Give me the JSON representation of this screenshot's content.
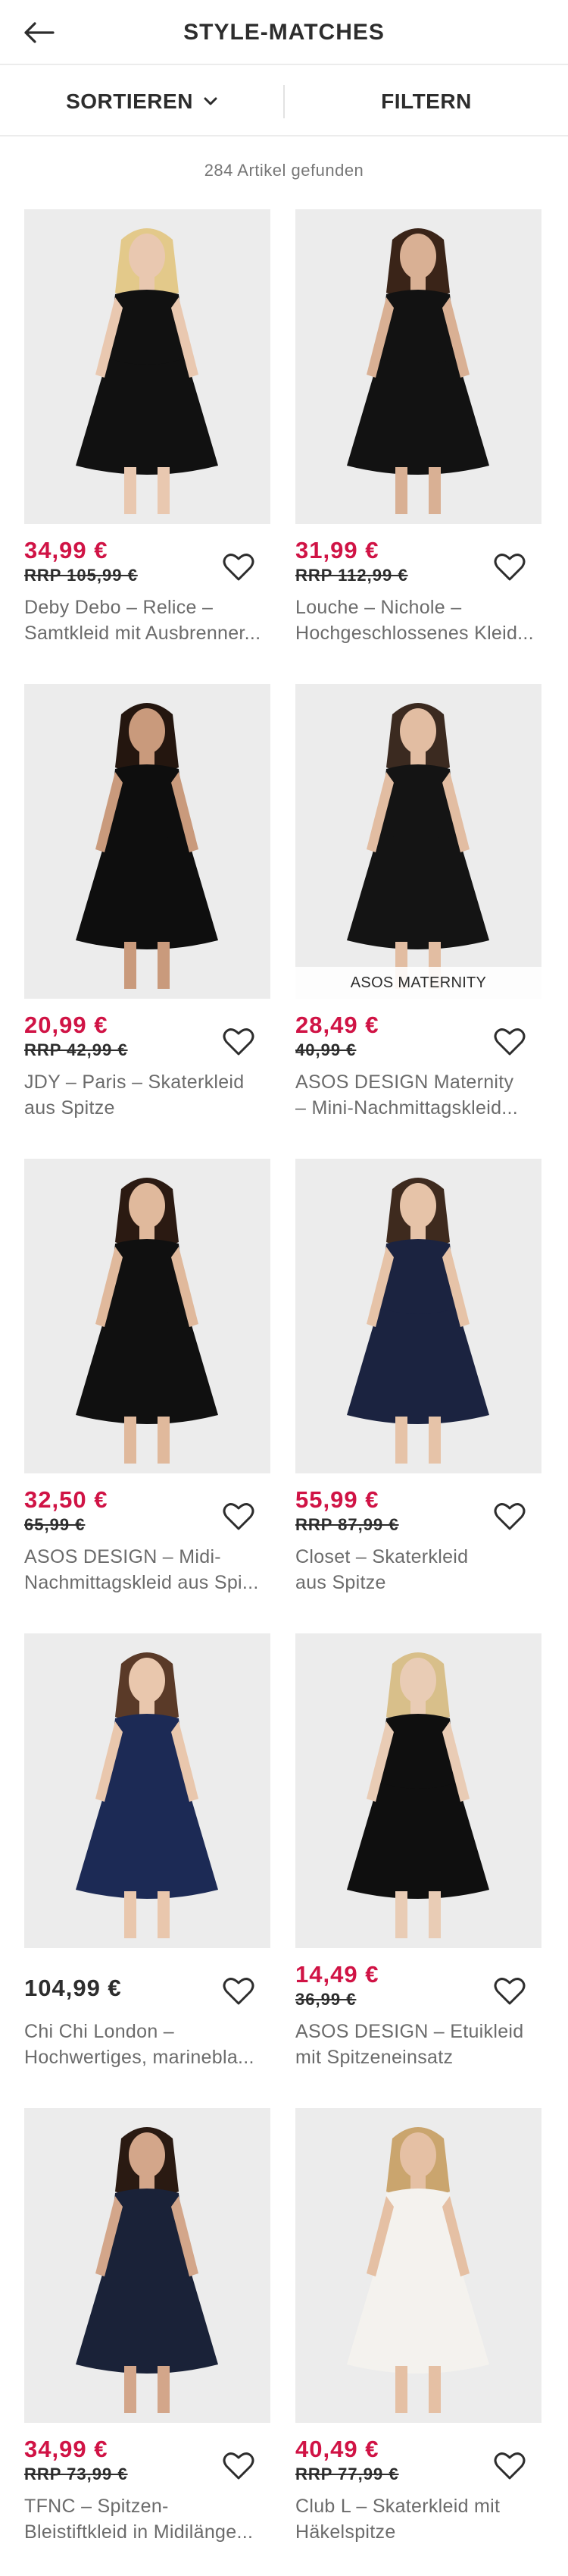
{
  "header": {
    "title": "STYLE-MATCHES",
    "back_icon": "arrow-left-icon"
  },
  "toolbar": {
    "sort_label": "SORTIEREN",
    "filter_label": "FILTERN"
  },
  "results": {
    "count_text": "284 Artikel gefunden"
  },
  "colors": {
    "sale_price": "#d01345",
    "text": "#2d2d2d",
    "muted": "#6b6b6b",
    "image_bg": "#ececec"
  },
  "products": [
    {
      "price": "34,99 €",
      "rrp": "RRP 105,99 €",
      "name_line1": "Deby Debo – Relice –",
      "name_line2": "Samtkleid mit Ausbrenner...",
      "badge": "",
      "on_sale": true
    },
    {
      "price": "31,99 €",
      "rrp": "RRP 112,99 €",
      "name_line1": "Louche – Nichole –",
      "name_line2": "Hochgeschlossenes Kleid...",
      "badge": "",
      "on_sale": true
    },
    {
      "price": "20,99 €",
      "rrp": "RRP 42,99 €",
      "name_line1": "JDY – Paris – Skaterkleid",
      "name_line2": "aus Spitze",
      "badge": "",
      "on_sale": true
    },
    {
      "price": "28,49 €",
      "rrp": "40,99 €",
      "name_line1": "ASOS DESIGN Maternity",
      "name_line2": "– Mini-Nachmittagskleid...",
      "badge": "ASOS MATERNITY",
      "on_sale": true
    },
    {
      "price": "32,50 €",
      "rrp": "65,99 €",
      "name_line1": "ASOS DESIGN – Midi-",
      "name_line2": "Nachmittagskleid aus Spi...",
      "badge": "",
      "on_sale": true
    },
    {
      "price": "55,99 €",
      "rrp": "RRP 87,99 €",
      "name_line1": "Closet – Skaterkleid",
      "name_line2": "aus Spitze",
      "badge": "",
      "on_sale": true
    },
    {
      "price": "104,99 €",
      "rrp": "",
      "name_line1": "Chi Chi London –",
      "name_line2": "Hochwertiges, marinebla...",
      "badge": "",
      "on_sale": false
    },
    {
      "price": "14,49 €",
      "rrp": "36,99 €",
      "name_line1": "ASOS DESIGN – Etuikleid",
      "name_line2": "mit Spitzeneinsatz",
      "badge": "",
      "on_sale": true
    },
    {
      "price": "34,99 €",
      "rrp": "RRP 73,99 €",
      "name_line1": "TFNC – Spitzen-",
      "name_line2": "Bleistiftkleid in Midilänge...",
      "badge": "",
      "on_sale": true
    },
    {
      "price": "40,49 €",
      "rrp": "RRP 77,99 €",
      "name_line1": "Club L – Skaterkleid mit",
      "name_line2": "Häkelspitze",
      "badge": "",
      "on_sale": true
    }
  ]
}
